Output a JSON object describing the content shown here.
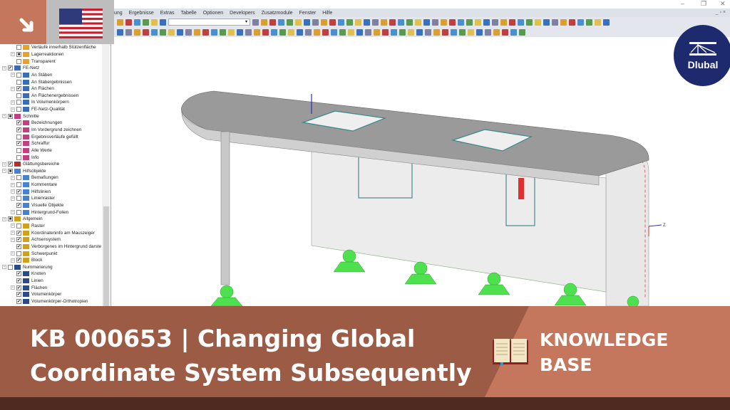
{
  "window": {
    "minimize": "–",
    "restore": "❐",
    "close": "✕",
    "mdi_controls": "_ ▫ ×"
  },
  "menu": [
    "ung",
    "Ergebnisse",
    "Extras",
    "Tabelle",
    "Optionen",
    "Developers",
    "Zusatzmodule",
    "Fenster",
    "Hilfe"
  ],
  "toolbar": {
    "combo_value": "▾"
  },
  "tree": [
    {
      "label": "Verläufe innerhalb Stützenfläche",
      "lvl": 1,
      "exp": false,
      "cb": "",
      "icon": "#e8a030"
    },
    {
      "label": "Lagerreaktionen",
      "lvl": 1,
      "exp": true,
      "cb": "■",
      "icon": "#e8a030"
    },
    {
      "label": "Transparent",
      "lvl": 1,
      "exp": false,
      "cb": "",
      "icon": "#e8a030"
    },
    {
      "label": "FE-Netz",
      "lvl": 0,
      "exp": true,
      "cb": "✔",
      "icon": "#3a6db5"
    },
    {
      "label": "An Stäben",
      "lvl": 1,
      "exp": true,
      "cb": "",
      "icon": "#3a6db5"
    },
    {
      "label": "An Stabergebnissen",
      "lvl": 1,
      "exp": false,
      "cb": "",
      "icon": "#3a6db5"
    },
    {
      "label": "An Flächen",
      "lvl": 1,
      "exp": true,
      "cb": "✔",
      "icon": "#3a6db5"
    },
    {
      "label": "An Flächenergebnissen",
      "lvl": 1,
      "exp": false,
      "cb": "",
      "icon": "#3a6db5"
    },
    {
      "label": "In Volumenkörpern",
      "lvl": 1,
      "exp": true,
      "cb": "",
      "icon": "#3a6db5"
    },
    {
      "label": "FE-Netz-Qualität",
      "lvl": 1,
      "exp": true,
      "cb": "",
      "icon": "#3a6db5"
    },
    {
      "label": "Schnitte",
      "lvl": 0,
      "exp": true,
      "cb": "■",
      "icon": "#c04080"
    },
    {
      "label": "Bezeichnungen",
      "lvl": 1,
      "exp": false,
      "cb": "✔",
      "icon": "#c04080"
    },
    {
      "label": "Im Vordergrund zeichnen",
      "lvl": 1,
      "exp": false,
      "cb": "✔",
      "icon": "#c04080"
    },
    {
      "label": "Ergebnisverläufe gefüllt",
      "lvl": 1,
      "exp": false,
      "cb": "",
      "icon": "#c04080"
    },
    {
      "label": "Schraffur",
      "lvl": 1,
      "exp": false,
      "cb": "✔",
      "icon": "#c04080"
    },
    {
      "label": "Alle Werte",
      "lvl": 1,
      "exp": false,
      "cb": "",
      "icon": "#c04080"
    },
    {
      "label": "Info",
      "lvl": 1,
      "exp": false,
      "cb": "",
      "icon": "#c04080"
    },
    {
      "label": "Glättungsbereiche",
      "lvl": 0,
      "exp": true,
      "cb": "✔",
      "icon": "#b03030"
    },
    {
      "label": "Hilfsobjekte",
      "lvl": 0,
      "exp": true,
      "cb": "■",
      "icon": "#4a80d0"
    },
    {
      "label": "Bemaßungen",
      "lvl": 1,
      "exp": true,
      "cb": "",
      "icon": "#4a80d0"
    },
    {
      "label": "Kommentare",
      "lvl": 1,
      "exp": true,
      "cb": "",
      "icon": "#4a80d0"
    },
    {
      "label": "Hilfslinien",
      "lvl": 1,
      "exp": true,
      "cb": "✔",
      "icon": "#4a80d0"
    },
    {
      "label": "Linienraster",
      "lvl": 1,
      "exp": true,
      "cb": "",
      "icon": "#4a80d0"
    },
    {
      "label": "Visuelle Objekte",
      "lvl": 1,
      "exp": false,
      "cb": "✔",
      "icon": "#4a80d0"
    },
    {
      "label": "Hintergrund-Folien",
      "lvl": 1,
      "exp": true,
      "cb": "",
      "icon": "#4a80d0"
    },
    {
      "label": "Allgemein",
      "lvl": 0,
      "exp": true,
      "cb": "■",
      "icon": "#d0a020"
    },
    {
      "label": "Raster",
      "lvl": 1,
      "exp": true,
      "cb": "",
      "icon": "#d0a020"
    },
    {
      "label": "Koordinateninfo am Mauszeiger",
      "lvl": 1,
      "exp": true,
      "cb": "✔",
      "icon": "#d0a020"
    },
    {
      "label": "Achsensystem",
      "lvl": 1,
      "exp": true,
      "cb": "✔",
      "icon": "#d0a020"
    },
    {
      "label": "Verborgenes im Hintergrund darste",
      "lvl": 1,
      "exp": false,
      "cb": "✔",
      "icon": "#d0a020"
    },
    {
      "label": "Schwerpunkt",
      "lvl": 1,
      "exp": true,
      "cb": "",
      "icon": "#d0a020"
    },
    {
      "label": "Block",
      "lvl": 1,
      "exp": true,
      "cb": "✔",
      "icon": "#d0a020"
    },
    {
      "label": "Nummerierung",
      "lvl": 0,
      "exp": true,
      "cb": "",
      "icon": "#2a4a8a"
    },
    {
      "label": "Knoten",
      "lvl": 1,
      "exp": false,
      "cb": "✔",
      "icon": "#2a4a8a"
    },
    {
      "label": "Linien",
      "lvl": 1,
      "exp": false,
      "cb": "✔",
      "icon": "#2a4a8a"
    },
    {
      "label": "Flächen",
      "lvl": 1,
      "exp": true,
      "cb": "✔",
      "icon": "#2a4a8a"
    },
    {
      "label": "Volumenkörper",
      "lvl": 1,
      "exp": false,
      "cb": "✔",
      "icon": "#2a4a8a"
    },
    {
      "label": "Volumenkörper-Orthotropien",
      "lvl": 1,
      "exp": false,
      "cb": "✔",
      "icon": "#2a4a8a"
    }
  ],
  "viewport": {
    "axis_label": "Z"
  },
  "logo": {
    "text": "Dlubal"
  },
  "banner": {
    "title_line1": "KB 000653 | Changing Global",
    "title_line2": "Coordinate System Subsequently",
    "category_line1": "KNOWLEDGE",
    "category_line2": "BASE"
  },
  "colors": {
    "accent": "#c4775c",
    "dark": "#9c5b45",
    "footer": "#4e2a20",
    "logo": "#1e2a6e",
    "support": "#4ee04e"
  }
}
